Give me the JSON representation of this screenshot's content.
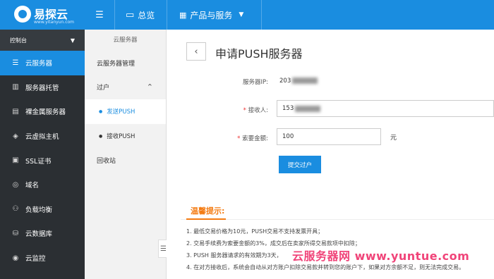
{
  "header": {
    "brand": "易探云",
    "domain": "www.yitanyun.com",
    "menu_icon": "menu-icon",
    "nav": [
      {
        "label": "总览",
        "icon": "monitor-icon"
      },
      {
        "label": "产品与服务",
        "icon": "grid-icon"
      }
    ]
  },
  "sidebar": {
    "console_label": "控制台",
    "items": [
      {
        "label": "云服务器",
        "icon": "server-icon"
      },
      {
        "label": "服务器托管",
        "icon": "rack-icon"
      },
      {
        "label": "裸金属服务器",
        "icon": "cube-icon"
      },
      {
        "label": "云虚拟主机",
        "icon": "box-icon"
      },
      {
        "label": "SSL证书",
        "icon": "certificate-icon"
      },
      {
        "label": "域名",
        "icon": "globe-icon"
      },
      {
        "label": "负载均衡",
        "icon": "balance-icon"
      },
      {
        "label": "云数据库",
        "icon": "database-icon"
      },
      {
        "label": "云监控",
        "icon": "monitor-icon"
      }
    ]
  },
  "subnav": {
    "title": "云服务器",
    "items": {
      "manage": "云服务器管理",
      "transfer": "过户",
      "send": "发送PUSH",
      "receive": "接收PUSH",
      "recycle": "回收站"
    }
  },
  "main": {
    "title": "申请PUSH服务器",
    "server_ip_label": "服务器IP:",
    "server_ip_value": "203",
    "receiver_label": "接收人:",
    "receiver_value": "153",
    "amount_label": "索要金额:",
    "amount_value": "100",
    "amount_unit": "元",
    "submit_label": "提交过户"
  },
  "tips": {
    "title": "温馨提示:",
    "items": [
      "1. 最低交易价格为10元，PUSH交易不支持发票开具；",
      "2. 交易手续费为索要金额的3%，成交后在卖家所得交易款项中扣除；",
      "3. PUSH 服务器请求的有效期为3天，",
      "4. 在对方接收后，系统会自动从对方账户扣除交易款并转到您的账户下，如果对方余额不足，则无法完成交易。"
    ]
  },
  "watermark": "云服务器网 www.yuntue.com",
  "colors": {
    "primary": "#1a8de0",
    "sidebar_bg": "#2b2f33",
    "tips_accent": "#f47b12",
    "required": "#e33333"
  }
}
